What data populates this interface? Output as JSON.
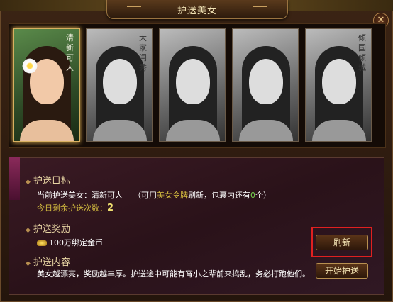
{
  "window": {
    "title": "护送美女",
    "close_glyph": "✕"
  },
  "portraits": [
    {
      "caption": "清新可人",
      "selected": true,
      "style": "color"
    },
    {
      "caption": "大家闺秀",
      "selected": false,
      "style": "gray"
    },
    {
      "caption": "",
      "selected": false,
      "style": "gray"
    },
    {
      "caption": "",
      "selected": false,
      "style": "gray"
    },
    {
      "caption": "倾国倾城",
      "selected": false,
      "style": "gray"
    }
  ],
  "target": {
    "title": "护送目标",
    "current_label": "当前护送美女：",
    "current_value": "清新可人",
    "hint_prefix": "（可用",
    "hint_item": "美女令牌",
    "hint_mid": "刷新，包裹内还有",
    "hint_count": "0",
    "hint_suffix": "个）",
    "remaining_label": "今日剩余护送次数：",
    "remaining_value": "2"
  },
  "reward": {
    "title": "护送奖励",
    "text": "100万绑定金币"
  },
  "content": {
    "title": "护送内容",
    "text": "美女越漂亮，奖励越丰厚。护送途中可能有宵小之辈前来捣乱，务必打跑他们。"
  },
  "buttons": {
    "refresh": "刷新",
    "start": "开始护送"
  },
  "colors": {
    "accent_gold": "#e9d6a4",
    "highlight_yellow": "#d8c040",
    "count_green": "#78d850",
    "selection_red": "#e02020"
  }
}
